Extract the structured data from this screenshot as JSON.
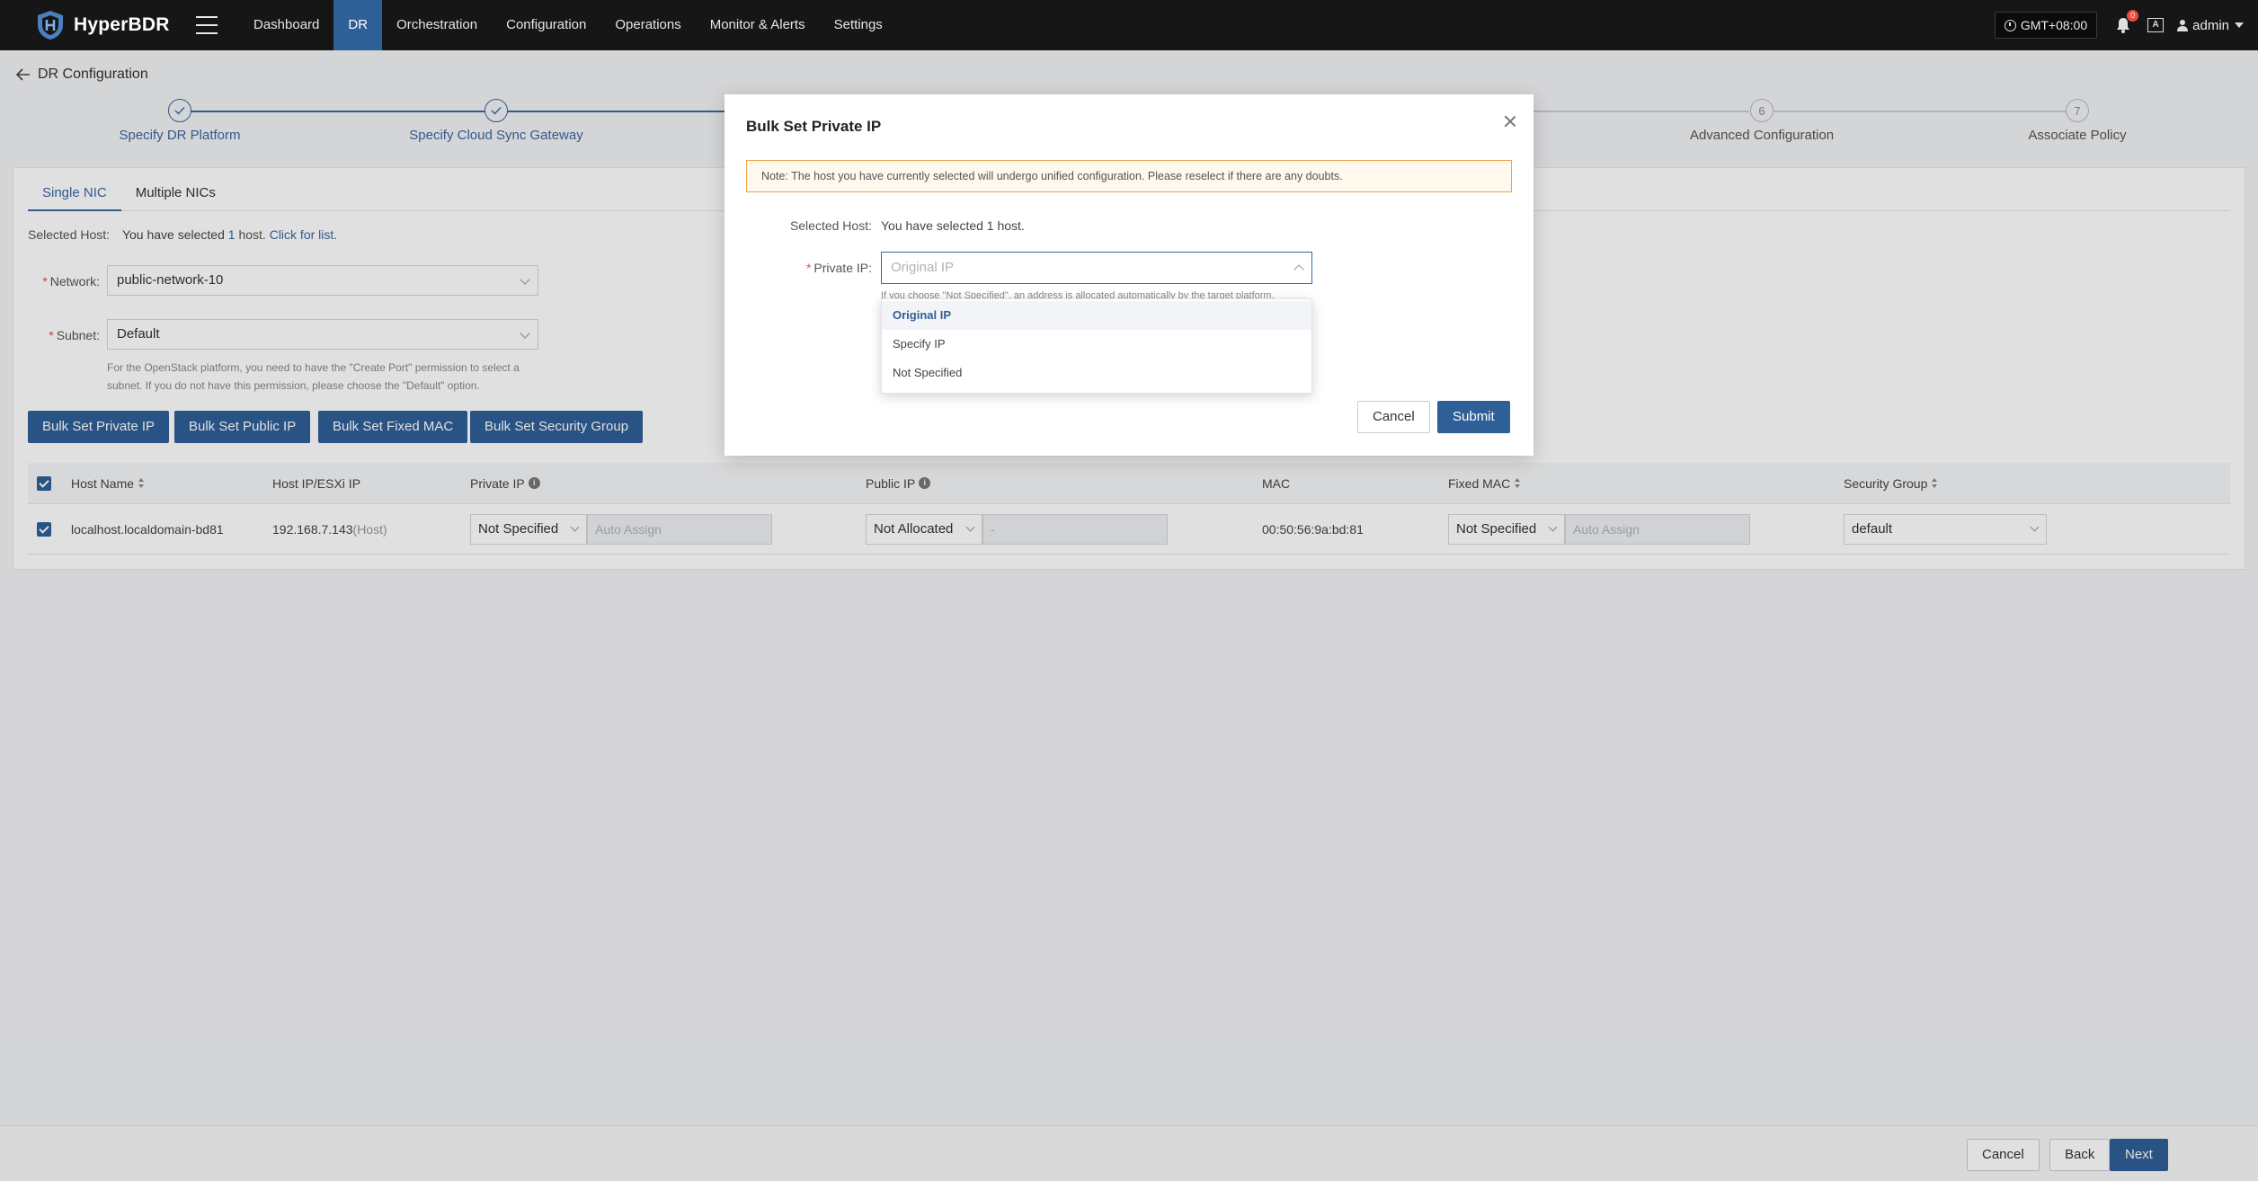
{
  "brand": {
    "name": "HyperBDR",
    "accent": "#2f5f97"
  },
  "nav": {
    "items": [
      {
        "label": "Dashboard"
      },
      {
        "label": "DR"
      },
      {
        "label": "Orchestration"
      },
      {
        "label": "Configuration"
      },
      {
        "label": "Operations"
      },
      {
        "label": "Monitor & Alerts"
      },
      {
        "label": "Settings"
      }
    ],
    "active": "DR",
    "timezone": "GMT+08:00",
    "notification_count": "0",
    "lang_icon": "A",
    "user": "admin"
  },
  "page": {
    "title": "DR Configuration"
  },
  "steps": [
    {
      "label": "Specify DR Platform",
      "state": "done"
    },
    {
      "label": "Specify Cloud Sync Gateway",
      "state": "done"
    },
    {
      "label": "Advanced Configuration",
      "number": "6",
      "state": "pending"
    },
    {
      "label": "Associate Policy",
      "number": "7",
      "state": "pending"
    }
  ],
  "tabs": [
    {
      "label": "Single NIC",
      "active": true
    },
    {
      "label": "Multiple NICs",
      "active": false
    }
  ],
  "form": {
    "selected_host_label": "Selected Host:",
    "selected_host_prefix": "You have selected",
    "selected_host_count": "1",
    "selected_host_unit": "host.",
    "selected_host_link": "Click for list",
    "selected_host_end": ".",
    "network_label": "Network:",
    "network_value": "public-network-10",
    "subnet_label": "Subnet:",
    "subnet_value": "Default",
    "subnet_hint": "For the OpenStack platform, you need to have the \"Create Port\" permission to select a subnet. If you do not have this permission, please choose the \"Default\" option."
  },
  "bulk_buttons": {
    "private_ip": "Bulk Set Private IP",
    "public_ip": "Bulk Set Public IP",
    "fixed_mac": "Bulk Set Fixed MAC",
    "security_group": "Bulk Set Security Group"
  },
  "table": {
    "headers": {
      "host_name": "Host Name",
      "host_ip": "Host IP/ESXi IP",
      "private_ip": "Private IP",
      "public_ip": "Public IP",
      "mac": "MAC",
      "fixed_mac": "Fixed MAC",
      "security_group": "Security Group"
    },
    "rows": [
      {
        "host_name": "localhost.localdomain-bd81",
        "host_ip": "192.168.7.143",
        "host_ip_suffix": "(Host)",
        "private_ip_mode": "Not Specified",
        "private_ip_placeholder": "Auto Assign",
        "public_ip_mode": "Not Allocated",
        "public_ip_placeholder": "-",
        "mac": "00:50:56:9a:bd:81",
        "fixed_mac_mode": "Not Specified",
        "fixed_mac_placeholder": "Auto Assign",
        "security_group": "default"
      }
    ]
  },
  "footer": {
    "cancel": "Cancel",
    "back": "Back",
    "next": "Next"
  },
  "modal": {
    "title": "Bulk Set Private IP",
    "notice": "Note: The host you have currently selected will undergo unified configuration. Please reselect if there are any doubts.",
    "selected_host_label": "Selected Host:",
    "selected_host_value": "You have selected 1 host.",
    "private_ip_label": "Private IP:",
    "private_ip_placeholder": "Original IP",
    "hint": "If you choose \"Not Specified\", an address is allocated automatically by the target platform.",
    "options": [
      "Original IP",
      "Specify IP",
      "Not Specified"
    ],
    "highlighted_option": "Original IP",
    "cancel": "Cancel",
    "submit": "Submit"
  }
}
